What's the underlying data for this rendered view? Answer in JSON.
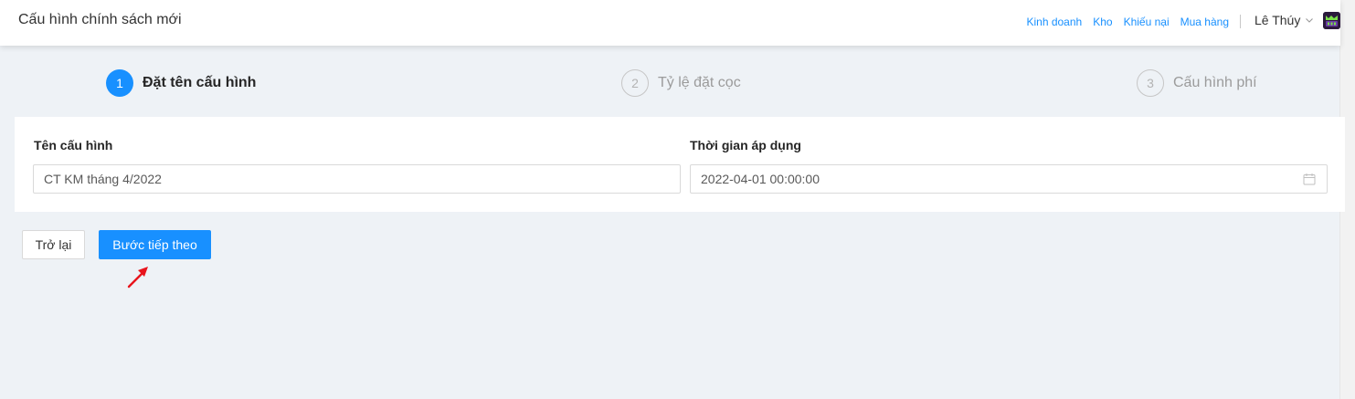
{
  "header": {
    "title": "Cấu hình chính sách mới",
    "nav": [
      "Kinh doanh",
      "Kho",
      "Khiếu nại",
      "Mua hàng"
    ],
    "user_name": "Lê Thúy"
  },
  "steps": [
    {
      "number": "1",
      "label": "Đặt tên cấu hình",
      "state": "active"
    },
    {
      "number": "2",
      "label": "Tỷ lệ đặt cọc",
      "state": "inactive"
    },
    {
      "number": "3",
      "label": "Cấu hình phí",
      "state": "inactive"
    }
  ],
  "form": {
    "name_label": "Tên cấu hình",
    "name_value": "CT KM tháng 4/2022",
    "time_label": "Thời gian áp dụng",
    "time_value": "2022-04-01 00:00:00"
  },
  "actions": {
    "back_label": "Trở lại",
    "next_label": "Bước tiếp theo"
  },
  "colors": {
    "primary": "#1890ff",
    "background": "#eef2f6",
    "annotation_arrow": "#e8141c"
  }
}
